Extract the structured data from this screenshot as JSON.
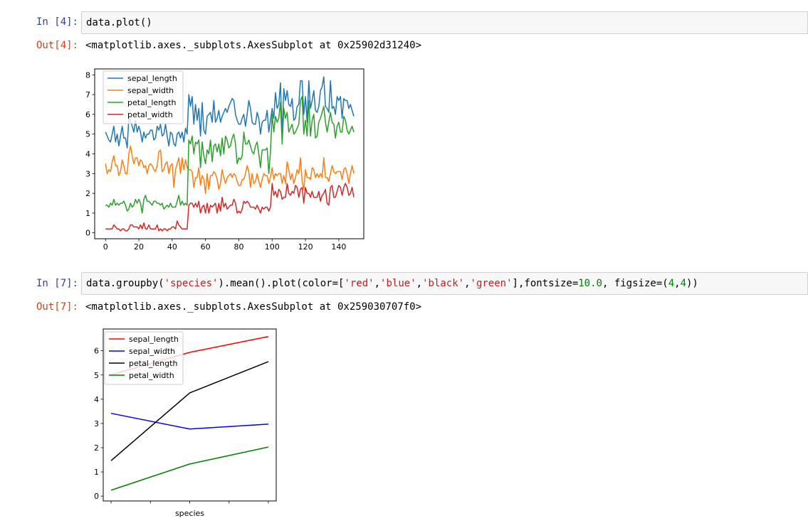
{
  "cell1": {
    "in_prompt": "In [4]:",
    "code": "data.plot()",
    "out_prompt": "Out[4]:",
    "output": "<matplotlib.axes._subplots.AxesSubplot at 0x25902d31240>"
  },
  "cell2": {
    "in_prompt": "In [7]:",
    "code_parts": [
      {
        "t": "data.groupby(",
        "c": "p"
      },
      {
        "t": "'species'",
        "c": "s"
      },
      {
        "t": ").mean().plot(color=[",
        "c": "p"
      },
      {
        "t": "'red'",
        "c": "s"
      },
      {
        "t": ",",
        "c": "p"
      },
      {
        "t": "'blue'",
        "c": "s"
      },
      {
        "t": ",",
        "c": "p"
      },
      {
        "t": "'black'",
        "c": "s"
      },
      {
        "t": ",",
        "c": "p"
      },
      {
        "t": "'green'",
        "c": "s"
      },
      {
        "t": "],fontsize=",
        "c": "p"
      },
      {
        "t": "10.0",
        "c": "n"
      },
      {
        "t": ", figsize=(",
        "c": "p"
      },
      {
        "t": "4",
        "c": "n"
      },
      {
        "t": ",",
        "c": "p"
      },
      {
        "t": "4",
        "c": "n"
      },
      {
        "t": "))",
        "c": "p"
      }
    ],
    "out_prompt": "Out[7]:",
    "output": "<matplotlib.axes._subplots.AxesSubplot at 0x259030707f0>"
  },
  "chart_data": [
    {
      "type": "line",
      "xlim": [
        -6.5,
        155
      ],
      "ylim": [
        -0.3,
        8.3
      ],
      "x_ticks": [
        0,
        20,
        40,
        60,
        80,
        100,
        120,
        140
      ],
      "y_ticks": [
        0,
        1,
        2,
        3,
        4,
        5,
        6,
        7,
        8
      ],
      "legend": "top-left",
      "series": [
        {
          "name": "sepal_length",
          "color": "#1f77b4",
          "values": [
            5.1,
            4.9,
            4.7,
            4.6,
            5.0,
            5.4,
            4.6,
            5.0,
            4.4,
            4.9,
            5.4,
            4.8,
            4.8,
            4.3,
            5.8,
            5.7,
            5.4,
            5.1,
            5.7,
            5.1,
            5.4,
            5.1,
            4.6,
            5.1,
            4.8,
            5.0,
            5.0,
            5.2,
            5.2,
            4.7,
            4.8,
            5.4,
            5.2,
            5.5,
            4.9,
            5.0,
            5.5,
            4.9,
            4.4,
            5.1,
            5.0,
            4.5,
            4.4,
            5.0,
            5.1,
            4.8,
            5.1,
            4.6,
            5.3,
            5.0,
            7.0,
            6.4,
            6.9,
            5.5,
            6.5,
            5.7,
            6.3,
            4.9,
            6.6,
            5.2,
            5.0,
            5.9,
            6.0,
            6.1,
            5.6,
            6.7,
            5.6,
            5.8,
            6.2,
            5.6,
            5.9,
            6.1,
            6.3,
            6.1,
            6.4,
            6.6,
            6.8,
            6.7,
            6.0,
            5.7,
            5.5,
            5.5,
            5.8,
            6.0,
            5.4,
            6.0,
            6.7,
            6.3,
            5.6,
            5.5,
            5.5,
            6.1,
            5.8,
            5.0,
            5.6,
            5.7,
            5.7,
            6.2,
            5.1,
            5.7,
            6.3,
            5.8,
            7.1,
            6.3,
            6.5,
            7.6,
            4.9,
            7.3,
            6.7,
            7.2,
            6.5,
            6.4,
            6.8,
            5.7,
            5.8,
            6.4,
            6.5,
            7.7,
            7.7,
            6.0,
            6.9,
            5.6,
            7.7,
            6.3,
            6.7,
            7.2,
            6.2,
            6.1,
            6.4,
            7.2,
            7.4,
            7.9,
            6.4,
            6.3,
            6.1,
            7.7,
            6.3,
            6.4,
            6.0,
            6.9,
            6.7,
            6.9,
            5.8,
            6.8,
            6.7,
            6.7,
            6.3,
            6.5,
            6.2,
            5.9
          ]
        },
        {
          "name": "sepal_width",
          "color": "#ff7f0e",
          "values": [
            3.5,
            3.0,
            3.2,
            3.1,
            3.6,
            3.9,
            3.4,
            3.4,
            2.9,
            3.1,
            3.7,
            3.4,
            3.0,
            3.0,
            4.0,
            4.4,
            3.9,
            3.5,
            3.8,
            3.8,
            3.4,
            3.7,
            3.6,
            3.3,
            3.4,
            3.0,
            3.4,
            3.5,
            3.4,
            3.2,
            3.1,
            3.4,
            4.1,
            4.2,
            3.1,
            3.2,
            3.5,
            3.6,
            3.0,
            3.4,
            3.5,
            2.3,
            3.2,
            3.5,
            3.8,
            3.0,
            3.8,
            3.2,
            3.7,
            3.3,
            3.2,
            3.2,
            3.1,
            2.3,
            2.8,
            2.8,
            3.3,
            2.4,
            2.9,
            2.7,
            2.0,
            3.0,
            2.2,
            2.9,
            2.9,
            3.1,
            3.0,
            2.7,
            2.2,
            2.5,
            3.2,
            2.8,
            2.5,
            2.8,
            2.9,
            3.0,
            2.8,
            3.0,
            2.9,
            2.6,
            2.4,
            2.4,
            2.7,
            2.7,
            3.0,
            3.4,
            3.1,
            2.3,
            3.0,
            2.5,
            2.6,
            3.0,
            2.6,
            2.3,
            2.7,
            3.0,
            2.9,
            2.9,
            2.5,
            2.8,
            3.3,
            2.7,
            3.0,
            2.9,
            3.0,
            3.0,
            2.5,
            2.9,
            2.5,
            3.6,
            3.2,
            2.7,
            3.0,
            2.5,
            2.8,
            3.2,
            3.0,
            3.8,
            2.6,
            2.2,
            3.2,
            2.8,
            2.8,
            2.7,
            3.3,
            3.2,
            2.8,
            3.0,
            2.8,
            3.0,
            2.8,
            3.8,
            2.8,
            2.8,
            2.6,
            3.0,
            3.4,
            3.1,
            3.0,
            3.1,
            3.1,
            3.1,
            2.7,
            3.2,
            3.3,
            3.0,
            2.5,
            3.0,
            3.4,
            3.0
          ]
        },
        {
          "name": "petal_length",
          "color": "#2ca02c",
          "values": [
            1.4,
            1.4,
            1.3,
            1.5,
            1.4,
            1.7,
            1.4,
            1.5,
            1.4,
            1.5,
            1.5,
            1.6,
            1.4,
            1.1,
            1.2,
            1.5,
            1.3,
            1.4,
            1.7,
            1.5,
            1.7,
            1.5,
            1.0,
            1.7,
            1.9,
            1.6,
            1.6,
            1.5,
            1.4,
            1.6,
            1.6,
            1.5,
            1.5,
            1.4,
            1.5,
            1.2,
            1.3,
            1.4,
            1.3,
            1.5,
            1.3,
            1.3,
            1.3,
            1.6,
            1.9,
            1.4,
            1.6,
            1.4,
            1.5,
            1.4,
            4.7,
            4.5,
            4.9,
            4.0,
            4.6,
            4.5,
            4.7,
            3.3,
            4.6,
            3.9,
            3.5,
            4.2,
            4.0,
            4.7,
            3.6,
            4.4,
            4.5,
            4.1,
            4.5,
            3.9,
            4.8,
            4.0,
            4.9,
            4.7,
            4.3,
            4.4,
            4.8,
            5.0,
            4.5,
            3.5,
            3.8,
            3.7,
            3.9,
            5.1,
            4.5,
            4.5,
            4.7,
            4.4,
            4.1,
            4.0,
            4.4,
            4.6,
            4.0,
            3.3,
            4.2,
            4.2,
            4.2,
            4.3,
            3.0,
            4.1,
            6.0,
            5.1,
            5.9,
            5.6,
            5.8,
            6.6,
            4.5,
            6.3,
            5.8,
            6.1,
            5.1,
            5.3,
            5.5,
            5.0,
            5.1,
            5.3,
            5.5,
            6.7,
            6.9,
            5.0,
            5.7,
            4.9,
            6.7,
            4.9,
            5.7,
            6.0,
            4.8,
            4.9,
            5.6,
            5.8,
            6.1,
            6.4,
            5.6,
            5.1,
            5.6,
            6.1,
            5.6,
            5.5,
            4.8,
            5.4,
            5.6,
            5.1,
            5.1,
            5.9,
            5.7,
            5.2,
            5.0,
            5.2,
            5.4,
            5.1
          ]
        },
        {
          "name": "petal_width",
          "color": "#d62728",
          "values": [
            0.2,
            0.2,
            0.2,
            0.2,
            0.2,
            0.4,
            0.3,
            0.2,
            0.2,
            0.1,
            0.2,
            0.2,
            0.1,
            0.1,
            0.2,
            0.4,
            0.4,
            0.3,
            0.3,
            0.3,
            0.2,
            0.4,
            0.2,
            0.5,
            0.2,
            0.2,
            0.4,
            0.2,
            0.2,
            0.2,
            0.2,
            0.4,
            0.1,
            0.2,
            0.1,
            0.2,
            0.2,
            0.1,
            0.2,
            0.2,
            0.3,
            0.3,
            0.2,
            0.6,
            0.4,
            0.3,
            0.2,
            0.2,
            0.2,
            0.2,
            1.4,
            1.5,
            1.5,
            1.3,
            1.5,
            1.3,
            1.6,
            1.0,
            1.3,
            1.4,
            1.0,
            1.5,
            1.0,
            1.4,
            1.3,
            1.4,
            1.5,
            1.0,
            1.5,
            1.1,
            1.8,
            1.3,
            1.5,
            1.2,
            1.3,
            1.4,
            1.4,
            1.7,
            1.5,
            1.0,
            1.1,
            1.0,
            1.2,
            1.6,
            1.5,
            1.6,
            1.5,
            1.3,
            1.3,
            1.3,
            1.2,
            1.4,
            1.2,
            1.0,
            1.3,
            1.2,
            1.3,
            1.3,
            1.1,
            1.3,
            2.5,
            1.9,
            2.1,
            1.8,
            2.2,
            2.1,
            1.7,
            1.8,
            1.8,
            2.5,
            2.0,
            1.9,
            2.1,
            2.0,
            2.4,
            2.3,
            1.8,
            2.2,
            2.3,
            1.5,
            2.3,
            2.0,
            2.0,
            1.8,
            2.1,
            1.8,
            1.8,
            1.8,
            2.1,
            1.6,
            1.9,
            2.0,
            2.2,
            1.5,
            1.4,
            2.3,
            2.4,
            1.8,
            1.8,
            2.1,
            2.4,
            2.3,
            1.9,
            2.3,
            2.5,
            2.3,
            1.9,
            2.0,
            2.3,
            1.8
          ]
        }
      ]
    },
    {
      "type": "line",
      "xlabel": "species",
      "x": [
        0,
        1,
        2
      ],
      "xlim": [
        -0.1,
        2.1
      ],
      "ylim": [
        -0.2,
        6.9
      ],
      "y_ticks": [
        0,
        1,
        2,
        3,
        4,
        5,
        6
      ],
      "x_minor_ticks": [
        0,
        0.5,
        1,
        1.5,
        2
      ],
      "legend": "top-left",
      "series": [
        {
          "name": "sepal_length",
          "color": "#ff0000",
          "values": [
            5.006,
            5.936,
            6.588
          ]
        },
        {
          "name": "sepal_width",
          "color": "#0000ff",
          "values": [
            3.418,
            2.77,
            2.974
          ]
        },
        {
          "name": "petal_length",
          "color": "#000000",
          "values": [
            1.464,
            4.26,
            5.552
          ]
        },
        {
          "name": "petal_width",
          "color": "#008000",
          "values": [
            0.244,
            1.326,
            2.026
          ]
        }
      ]
    }
  ]
}
